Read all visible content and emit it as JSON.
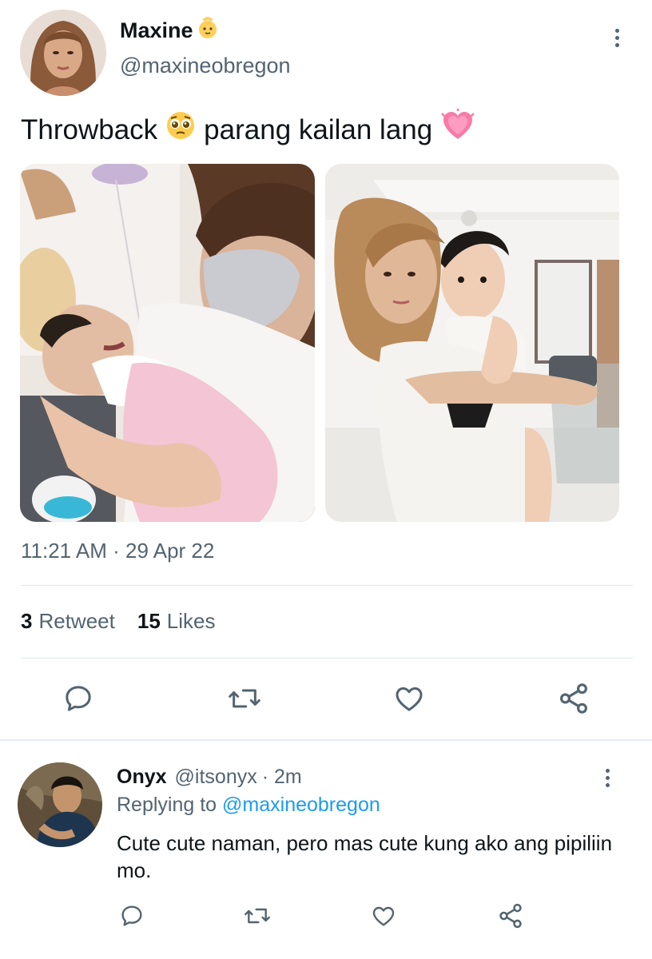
{
  "tweet": {
    "author_name": "Maxine",
    "author_emoji": "baby-emoji",
    "handle": "@maxineobregon",
    "text_part1": "Throwback",
    "text_emoji1": "pleading-face-emoji",
    "text_part2": "parang kailan lang",
    "text_emoji2": "growing-heart-emoji",
    "media": [
      "photo-woman-holding-newborn",
      "photo-woman-holding-baby"
    ],
    "timestamp": "11:21 AM · 29 Apr 22",
    "retweets_count": "3",
    "retweets_label": "Retweet",
    "likes_count": "15",
    "likes_label": "Likes",
    "actions": [
      "reply-icon",
      "retweet-icon",
      "like-icon",
      "share-icon"
    ]
  },
  "reply": {
    "author_name": "Onyx",
    "handle": "@itsonyx",
    "time": "· 2m",
    "replying_prefix": "Replying to",
    "replying_to": "@maxineobregon",
    "text": "Cute cute naman, pero mas cute kung ako ang pipiliin mo.",
    "actions": [
      "reply-icon",
      "retweet-icon",
      "like-icon",
      "share-icon"
    ]
  },
  "colors": {
    "link": "#1d9bf0",
    "secondary_text": "#536471",
    "primary_text": "#0f1419",
    "heart_emoji": "#f77ba7"
  }
}
